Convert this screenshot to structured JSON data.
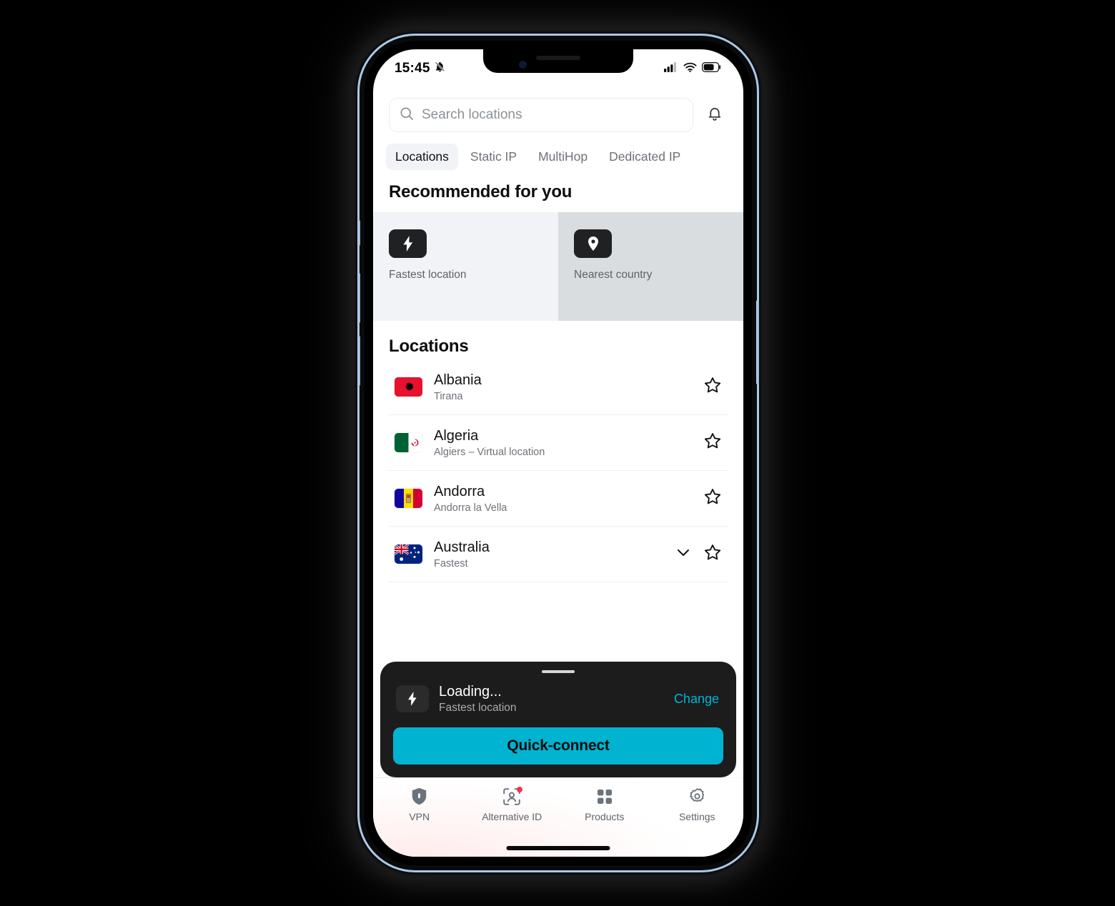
{
  "status_bar": {
    "time": "15:45",
    "icons": [
      "silent-mode-icon",
      "cellular-signal-icon",
      "wifi-icon",
      "battery-icon"
    ]
  },
  "search": {
    "placeholder": "Search locations",
    "value": "",
    "icon": "search-icon"
  },
  "notifications": {
    "icon": "bell-icon"
  },
  "tabs": [
    {
      "label": "Locations",
      "active": true
    },
    {
      "label": "Static IP",
      "active": false
    },
    {
      "label": "MultiHop",
      "active": false
    },
    {
      "label": "Dedicated IP",
      "active": false
    }
  ],
  "recommended": {
    "title": "Recommended for you",
    "cards": [
      {
        "label": "Fastest location",
        "icon": "lightning-bolt-icon",
        "bg": "#f1f3f6"
      },
      {
        "label": "Nearest country",
        "icon": "map-pin-icon",
        "bg": "#d9dde0"
      }
    ]
  },
  "locations": {
    "title": "Locations",
    "items": [
      {
        "country": "Albania",
        "city": "Tirana",
        "flag": "albania-flag",
        "favorite": false
      },
      {
        "country": "Algeria",
        "city": "Algiers – Virtual location",
        "flag": "algeria-flag",
        "favorite": false
      },
      {
        "country": "Andorra",
        "city": "Andorra la Vella",
        "flag": "andorra-flag",
        "favorite": false
      },
      {
        "country": "Australia",
        "city": "Fastest",
        "flag": "australia-flag",
        "favorite": false
      }
    ]
  },
  "connect_sheet": {
    "status": "Loading...",
    "subtitle": "Fastest location",
    "icon": "lightning-bolt-icon",
    "change_label": "Change",
    "quick_connect_label": "Quick-connect",
    "accent_color": "#00b3d1",
    "link_color": "#00b6d6",
    "background_color": "#1c1c1c"
  },
  "bottom_nav": {
    "items": [
      {
        "label": "VPN",
        "icon": "shield-icon",
        "badge": false
      },
      {
        "label": "Alternative ID",
        "icon": "person-scan-icon",
        "badge": true
      },
      {
        "label": "Products",
        "icon": "grid-squares-icon",
        "badge": false
      },
      {
        "label": "Settings",
        "icon": "gear-icon",
        "badge": false
      }
    ],
    "badge_color": "#f5334f"
  }
}
